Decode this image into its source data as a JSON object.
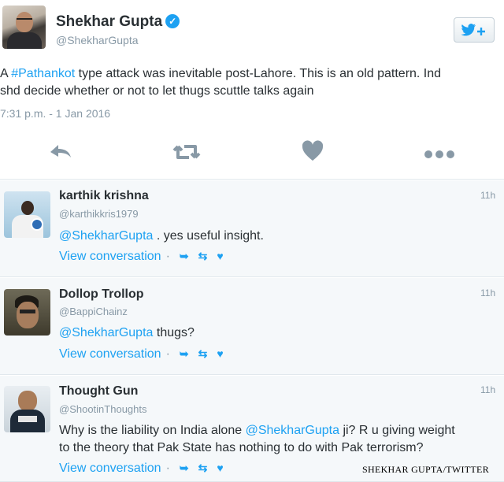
{
  "main_tweet": {
    "name": "Shekhar Gupta",
    "handle": "@ShekharGupta",
    "follow_icon": "twitter-bird-plus-icon",
    "text_before_hashtag": "A ",
    "hashtag": "#Pathankot",
    "text_line1_rest": " type attack was inevitable post-Lahore. This is an old pattern. Ind",
    "text_line2": "shd decide whether or not to let thugs scuttle talks again",
    "timestamp": "7:31 p.m. - 1 Jan 2016",
    "actions": [
      "reply-icon",
      "retweet-icon",
      "like-icon",
      "more-icon"
    ]
  },
  "replies": [
    {
      "name": "karthik krishna",
      "handle": "@karthikkris1979",
      "time": "11h",
      "mention": "@ShekharGupta",
      "text": " . yes useful insight.",
      "view_label": "View conversation"
    },
    {
      "name": "Dollop Trollop",
      "handle": "@BappiChainz",
      "time": "11h",
      "mention": "@ShekharGupta",
      "text": " thugs?",
      "view_label": "View conversation"
    },
    {
      "name": "Thought Gun",
      "handle": "@ShootinThoughts",
      "time": "11h",
      "text_before": "Why is the liability on India alone ",
      "mention": "@ShekharGupta",
      "text_after": " ji? R u giving weight",
      "text_line2": "to the theory that Pak State has nothing to do with Pak terrorism?",
      "view_label": "View conversation"
    }
  ],
  "footer": {
    "separator": "·",
    "reply_glyph": "⬑",
    "retweet_glyph": "⇄",
    "like_glyph": "♥"
  },
  "credit": "SHEKHAR GUPTA/TWITTER",
  "colors": {
    "link": "#1da1f2",
    "muted": "#8899a6",
    "text": "#292f33",
    "reply_bg": "#f5f8fa"
  }
}
